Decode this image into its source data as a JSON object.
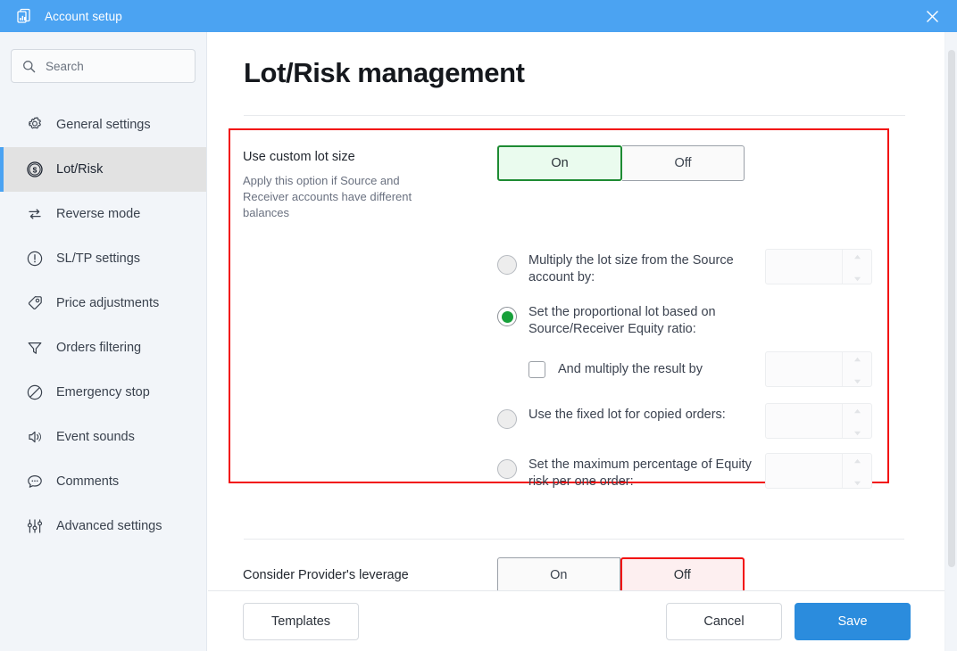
{
  "titlebar": {
    "title": "Account setup",
    "app_icon": "documents-chart-icon",
    "close_icon": "close-icon"
  },
  "sidebar": {
    "search": {
      "placeholder": "Search",
      "value": "",
      "icon": "search-icon"
    },
    "items": [
      {
        "label": "General settings",
        "icon": "gear-icon",
        "active": false
      },
      {
        "label": "Lot/Risk",
        "icon": "dollar-circle-icon",
        "active": true
      },
      {
        "label": "Reverse mode",
        "icon": "swap-arrows-icon",
        "active": false
      },
      {
        "label": "SL/TP settings",
        "icon": "exclamation-circle-icon",
        "active": false
      },
      {
        "label": "Price adjustments",
        "icon": "tag-icon",
        "active": false
      },
      {
        "label": "Orders filtering",
        "icon": "funnel-icon",
        "active": false
      },
      {
        "label": "Emergency stop",
        "icon": "ban-icon",
        "active": false
      },
      {
        "label": "Event sounds",
        "icon": "speaker-icon",
        "active": false
      },
      {
        "label": "Comments",
        "icon": "comment-bubble-icon",
        "active": false
      },
      {
        "label": "Advanced settings",
        "icon": "sliders-icon",
        "active": false
      }
    ]
  },
  "main": {
    "page_title": "Lot/Risk management",
    "custom_lot": {
      "label": "Use custom lot size",
      "description": "Apply this option if Source and Receiver accounts have different balances",
      "toggle": {
        "on_label": "On",
        "off_label": "Off",
        "selected": "On"
      },
      "options": [
        {
          "text": "Multiply the lot size from the Source account by:",
          "checked": false,
          "input_value": "",
          "spinner": true
        },
        {
          "text": "Set the proportional lot based on Source/Receiver Equity ratio:",
          "checked": true,
          "input_value": "",
          "spinner": false
        },
        {
          "text": "Use the fixed lot for copied orders:",
          "checked": false,
          "input_value": "",
          "spinner": true
        },
        {
          "text": "Set the maximum percentage of Equity risk per one order:",
          "checked": false,
          "input_value": "",
          "spinner": true
        }
      ],
      "sub_option": {
        "text": "And multiply the result by",
        "checked": false,
        "input_value": ""
      }
    },
    "provider_leverage": {
      "label": "Consider Provider's leverage",
      "toggle": {
        "on_label": "On",
        "off_label": "Off",
        "selected": "Off"
      }
    }
  },
  "footer": {
    "templates_label": "Templates",
    "cancel_label": "Cancel",
    "save_label": "Save"
  },
  "colors": {
    "titlebar": "#4ba3f2",
    "accent": "#2b8cdd",
    "highlight_border": "#f20d0d",
    "toggle_on_border": "#1e8b33",
    "toggle_on_bg": "#eafbee",
    "toggle_off_border": "#f20d0d",
    "toggle_off_bg": "#fdeff0",
    "radio_selected": "#17a03a"
  }
}
